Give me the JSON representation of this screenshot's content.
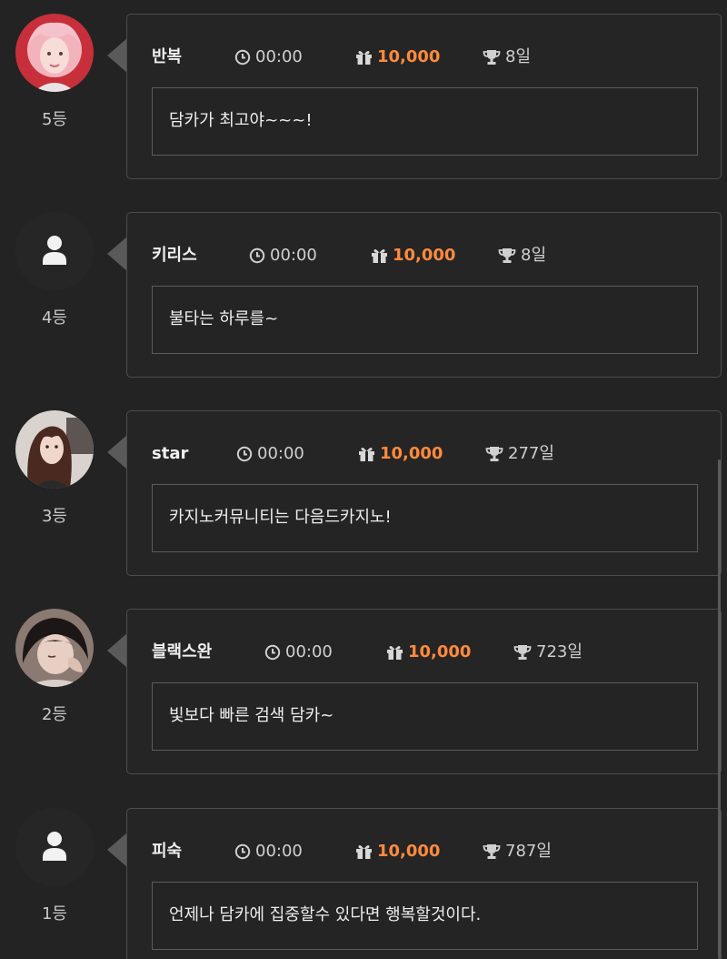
{
  "entries": [
    {
      "rank": "5등",
      "name": "반복",
      "time": "00:00",
      "gift": "10,000",
      "days": "8일",
      "message": "담카가 최고야~~~!",
      "avatar": "photo-pink-hair",
      "icons": {
        "time": "clock-icon",
        "gift": "gift-icon",
        "days": "trophy-icon"
      }
    },
    {
      "rank": "4등",
      "name": "키리스",
      "time": "00:00",
      "gift": "10,000",
      "days": "8일",
      "message": "불타는 하루를~",
      "avatar": "default-user-icon",
      "icons": {
        "time": "clock-icon",
        "gift": "gift-icon",
        "days": "trophy-icon"
      }
    },
    {
      "rank": "3등",
      "name": "star",
      "time": "00:00",
      "gift": "10,000",
      "days": "277일",
      "message": "카지노커뮤니티는 다음드카지노!",
      "avatar": "photo-brown-hair",
      "icons": {
        "time": "clock-icon",
        "gift": "gift-icon",
        "days": "trophy-icon"
      }
    },
    {
      "rank": "2등",
      "name": "블랙스완",
      "time": "00:00",
      "gift": "10,000",
      "days": "723일",
      "message": "빛보다 빠른 검색 담카~",
      "avatar": "photo-dark-hair",
      "icons": {
        "time": "clock-icon",
        "gift": "gift-icon",
        "days": "trophy-icon"
      }
    },
    {
      "rank": "1등",
      "name": "피숙",
      "time": "00:00",
      "gift": "10,000",
      "days": "787일",
      "message": "언제나 담카에 집중할수 있다면 행복할것이다.",
      "avatar": "default-user-icon",
      "icons": {
        "time": "clock-icon",
        "gift": "gift-icon",
        "days": "trophy-icon"
      }
    }
  ],
  "colors": {
    "background": "#232323",
    "card_border": "#4d4d4d",
    "gift_accent": "#ff8a3d",
    "text": "#eaeaea"
  }
}
